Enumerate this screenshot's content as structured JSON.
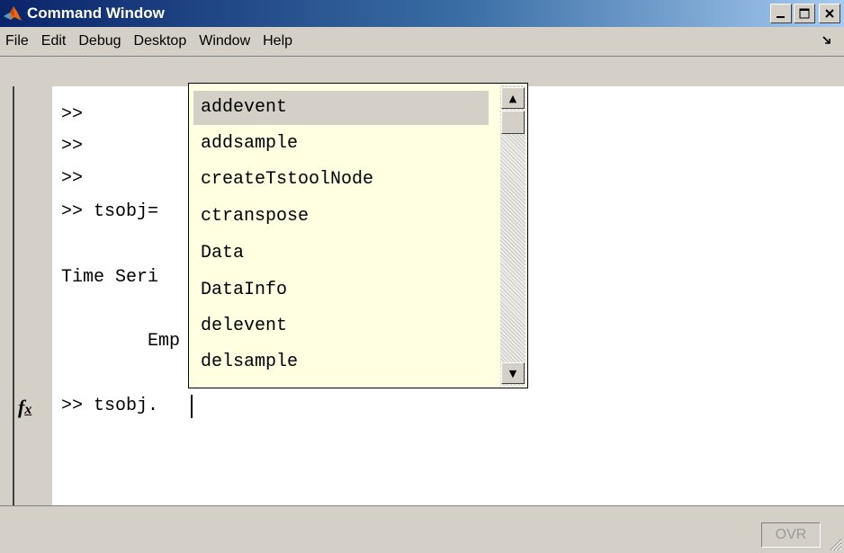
{
  "window": {
    "title": "Command Window"
  },
  "menu": [
    "File",
    "Edit",
    "Debug",
    "Desktop",
    "Window",
    "Help"
  ],
  "console": {
    "lines": [
      ">>",
      ">>",
      ">>",
      ">> tsobj=",
      "Time Seri",
      "Emp"
    ],
    "current_input": ">> tsobj."
  },
  "autocomplete": {
    "items": [
      "addevent",
      "addsample",
      "createTstoolNode",
      "ctranspose",
      "Data",
      "DataInfo",
      "delevent",
      "delsample"
    ],
    "selected_index": 0
  },
  "status": {
    "ovr": "OVR"
  },
  "icons": {
    "app": "matlab-logo-icon",
    "minimize": "minimize-icon",
    "maximize": "maximize-icon",
    "close": "close-icon",
    "dock": "dock-arrow-icon",
    "fx": "function-browser-icon",
    "scroll_up": "scroll-up-icon",
    "scroll_down": "scroll-down-icon",
    "resize_grip": "resize-grip-icon"
  },
  "colors": {
    "titlebar_start": "#0a246a",
    "titlebar_end": "#a6caf0",
    "popup_bg": "#ffffe1",
    "chrome": "#d4d0c8"
  }
}
